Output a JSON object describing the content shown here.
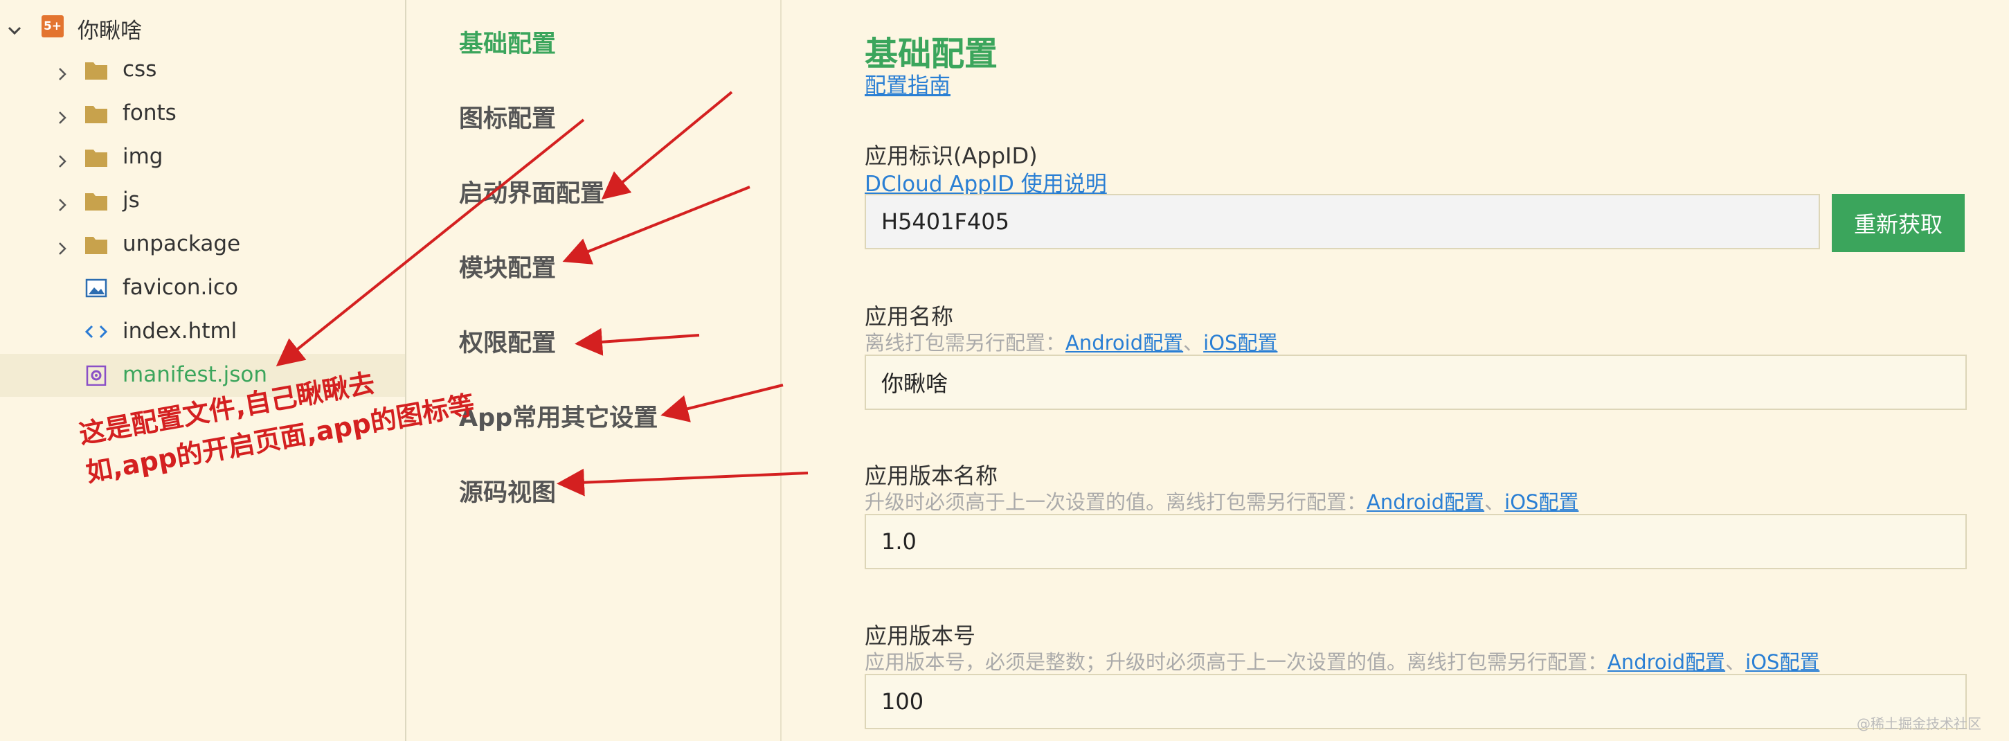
{
  "project": {
    "name": "你瞅啥",
    "badge": "5+",
    "items": [
      {
        "label": "css",
        "type": "folder",
        "icon": "folder-icon"
      },
      {
        "label": "fonts",
        "type": "folder",
        "icon": "folder-icon"
      },
      {
        "label": "img",
        "type": "folder",
        "icon": "folder-icon"
      },
      {
        "label": "js",
        "type": "folder",
        "icon": "folder-icon"
      },
      {
        "label": "unpackage",
        "type": "folder",
        "icon": "folder-icon"
      },
      {
        "label": "favicon.ico",
        "type": "file",
        "icon": "image-file-icon"
      },
      {
        "label": "index.html",
        "type": "file",
        "icon": "code-file-icon"
      },
      {
        "label": "manifest.json",
        "type": "file",
        "icon": "settings-file-icon",
        "selected": true
      }
    ]
  },
  "nav": {
    "items": [
      {
        "label": "基础配置",
        "active": true
      },
      {
        "label": "图标配置"
      },
      {
        "label": "启动界面配置"
      },
      {
        "label": "模块配置"
      },
      {
        "label": "权限配置"
      },
      {
        "label": "App常用其它设置"
      },
      {
        "label": "源码视图"
      }
    ]
  },
  "main": {
    "title": "基础配置",
    "guide_link": "配置指南",
    "fields": {
      "appid": {
        "label": "应用标识(AppID)",
        "help_link": "DCloud AppID 使用说明",
        "value": "H5401F405",
        "button": "重新获取"
      },
      "app_name": {
        "label": "应用名称",
        "hint": "离线打包需另行配置：",
        "android_link": "Android配置",
        "sep": "、",
        "ios_link": "iOS配置",
        "value": "你瞅啥"
      },
      "version_name": {
        "label": "应用版本名称",
        "hint": "升级时必须高于上一次设置的值。离线打包需另行配置：",
        "android_link": "Android配置",
        "sep": "、",
        "ios_link": "iOS配置",
        "value": "1.0"
      },
      "version_code": {
        "label": "应用版本号",
        "hint": "应用版本号，必须是整数；升级时必须高于上一次设置的值。离线打包需另行配置：",
        "android_link": "Android配置",
        "sep": "、",
        "ios_link": "iOS配置",
        "value": "100"
      }
    }
  },
  "annotation": {
    "line1": "这是配置文件,自己瞅瞅去",
    "line2": "如,app的开启页面,app的图标等",
    "color": "#d42020"
  },
  "colors": {
    "accent": "#3ba55c",
    "link": "#2a7fd4",
    "background": "#fdf6e3"
  },
  "watermark": "@稀土掘金技术社区"
}
